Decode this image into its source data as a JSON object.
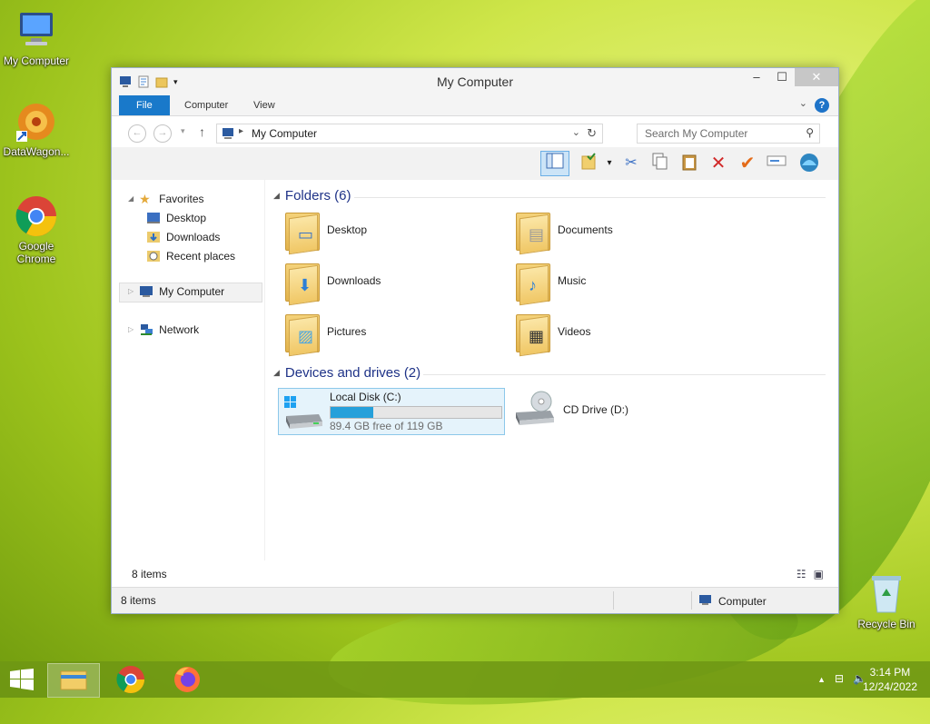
{
  "desktop": {
    "icons": [
      {
        "label": "My Computer"
      },
      {
        "label": "DataWagon..."
      },
      {
        "label": "Google Chrome"
      },
      {
        "label": "Recycle Bin"
      }
    ]
  },
  "window": {
    "title": "My Computer",
    "tabs": {
      "file": "File",
      "computer": "Computer",
      "view": "View"
    },
    "address": {
      "location": "My Computer"
    },
    "search": {
      "placeholder": "Search My Computer"
    },
    "nav": {
      "favorites": "Favorites",
      "desktop": "Desktop",
      "downloads": "Downloads",
      "recent": "Recent places",
      "my_computer": "My Computer",
      "network": "Network"
    },
    "folders": {
      "header": "Folders (6)",
      "items": [
        {
          "label": "Desktop"
        },
        {
          "label": "Documents"
        },
        {
          "label": "Downloads"
        },
        {
          "label": "Music"
        },
        {
          "label": "Pictures"
        },
        {
          "label": "Videos"
        }
      ]
    },
    "devices": {
      "header": "Devices and drives (2)",
      "local": {
        "name": "Local Disk (C:)",
        "free": "89.4 GB free of 119 GB",
        "used_fraction": 0.25
      },
      "cd": {
        "name": "CD Drive (D:)"
      }
    },
    "status": {
      "items": "8 items",
      "items_bottom": "8 items",
      "location": "Computer"
    }
  },
  "taskbar": {
    "time": "3:14 PM",
    "date": "12/24/2022"
  },
  "colors": {
    "accent": "#1979ca",
    "drive_fill": "#26a0da",
    "selection": "#e5f3fb"
  }
}
